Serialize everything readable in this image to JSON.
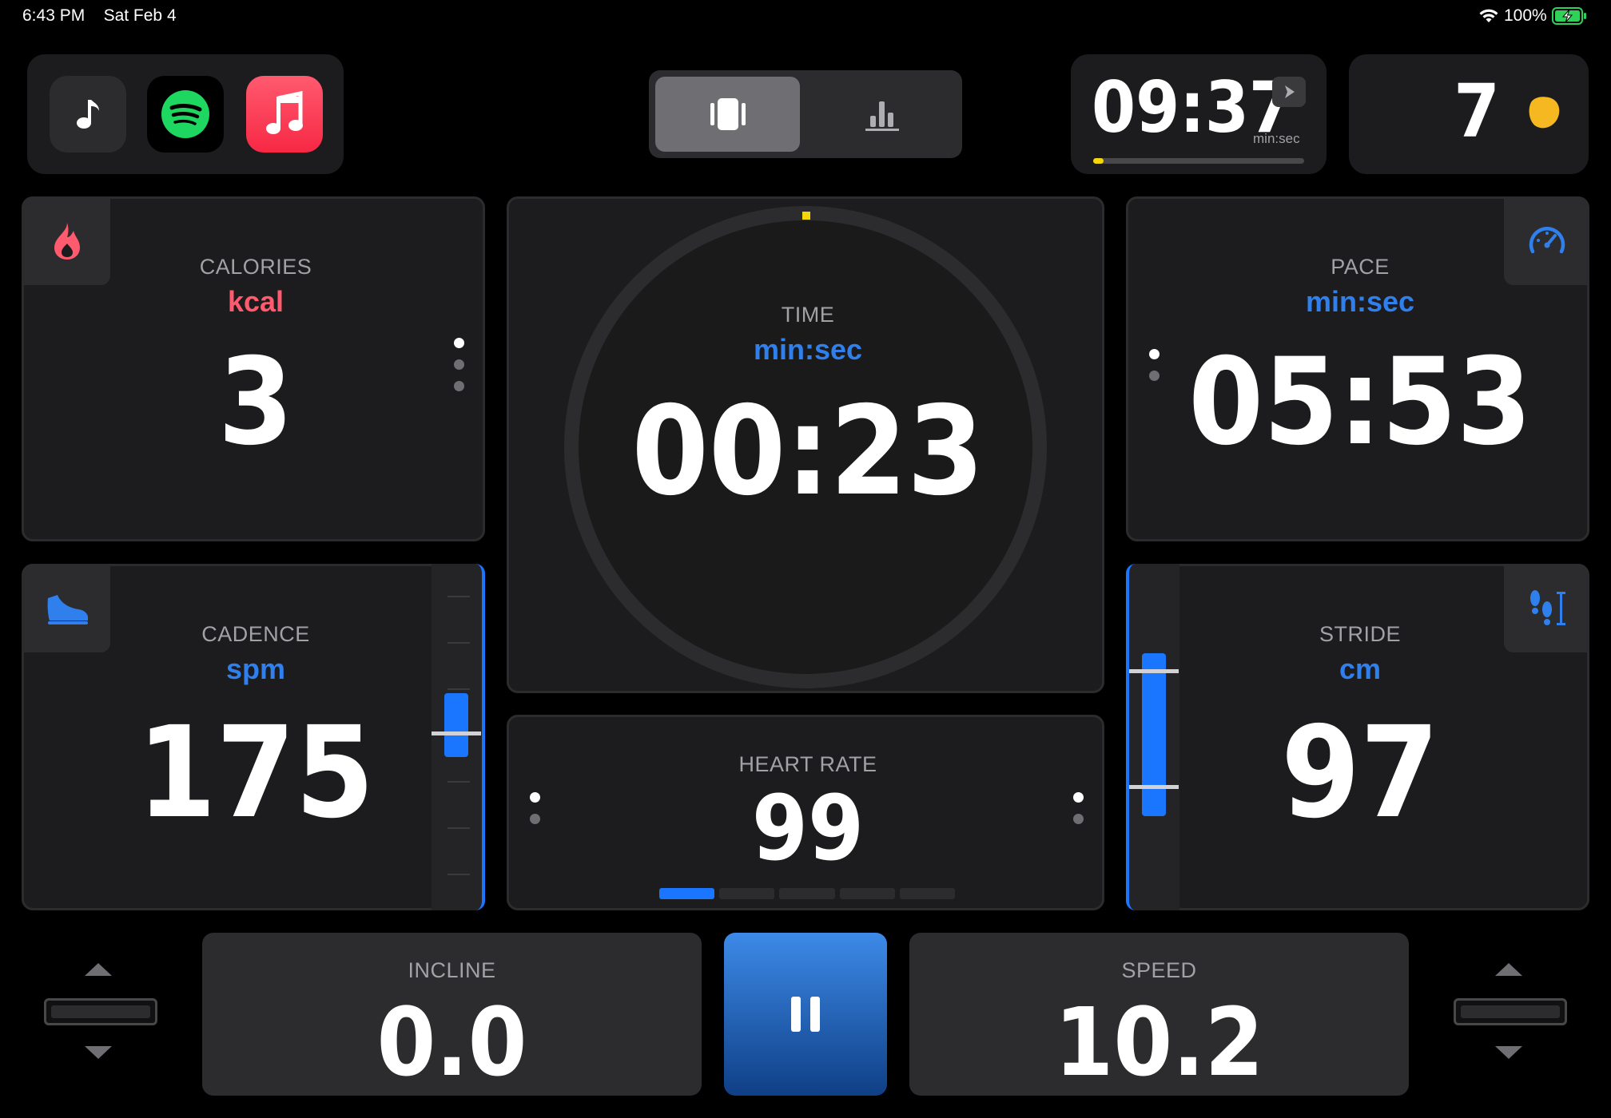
{
  "status": {
    "time": "6:43 PM",
    "date": "Sat Feb 4",
    "battery": "100%"
  },
  "colors": {
    "accent_blue": "#1a75ff",
    "calories_red": "#ff5a6e",
    "gold": "#f5b820",
    "panel": "#1c1c1e"
  },
  "apps": [
    {
      "name": "music-note",
      "icon": "music-note-icon"
    },
    {
      "name": "spotify",
      "icon": "spotify-icon"
    },
    {
      "name": "apple-music",
      "icon": "apple-music-icon"
    }
  ],
  "view_toggle": {
    "active": "cards",
    "options": [
      "cards-icon",
      "bar-chart-icon"
    ]
  },
  "interval": {
    "time": "09:37",
    "unit": "min:sec",
    "progress": 0.05
  },
  "medal": {
    "count": "7"
  },
  "calories": {
    "label": "CALORIES",
    "unit": "kcal",
    "value": "3"
  },
  "time_panel": {
    "label": "TIME",
    "unit": "min:sec",
    "value": "00:23",
    "ring_progress": 0.0
  },
  "pace": {
    "label": "PACE",
    "unit": "min:sec",
    "value": "05:53"
  },
  "cadence": {
    "label": "CADENCE",
    "unit": "spm",
    "value": "175"
  },
  "heart_rate": {
    "label": "HEART RATE",
    "value": "99",
    "zone": 1,
    "zones": 5
  },
  "stride": {
    "label": "STRIDE",
    "unit": "cm",
    "value": "97"
  },
  "incline": {
    "label": "INCLINE",
    "value": "0.0"
  },
  "speed": {
    "label": "SPEED",
    "value": "10.2"
  }
}
